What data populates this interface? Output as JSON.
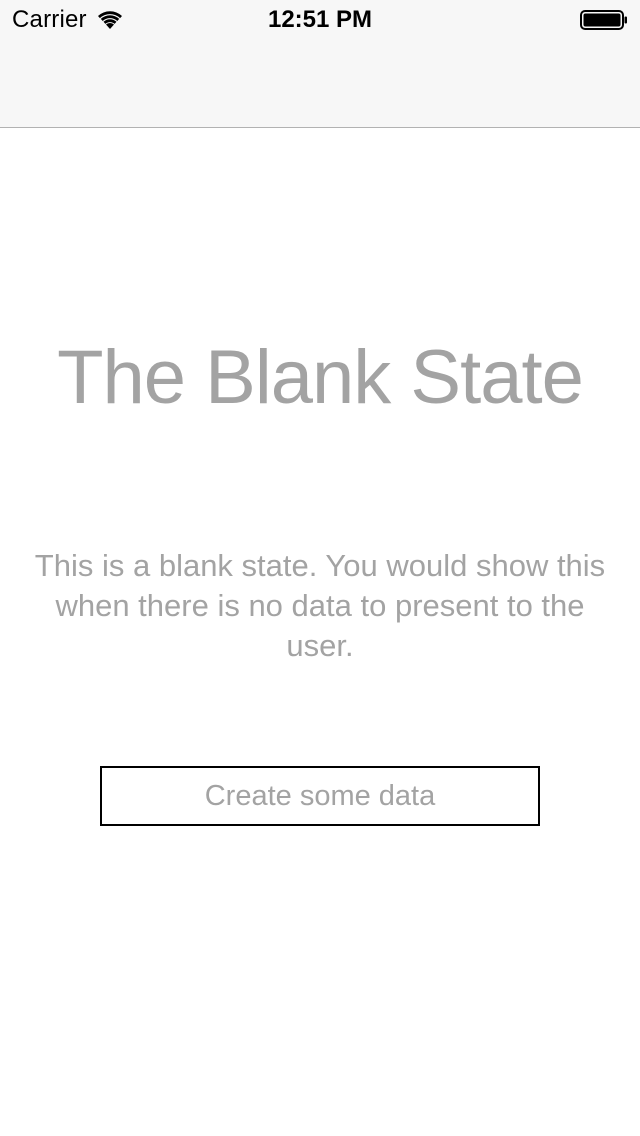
{
  "status_bar": {
    "carrier": "Carrier",
    "time": "12:51 PM",
    "wifi_icon": "wifi-icon",
    "battery_icon": "battery-icon"
  },
  "nav_bar": {
    "title": ""
  },
  "blank_state": {
    "title": "The Blank State",
    "message": "This is a blank state. You would show this when there is no data to present to the user.",
    "button_label": "Create some data"
  },
  "colors": {
    "text_gray": "#a3a3a3",
    "nav_background": "#f7f7f7",
    "nav_border": "#b2b2b2",
    "button_border": "#000000"
  }
}
